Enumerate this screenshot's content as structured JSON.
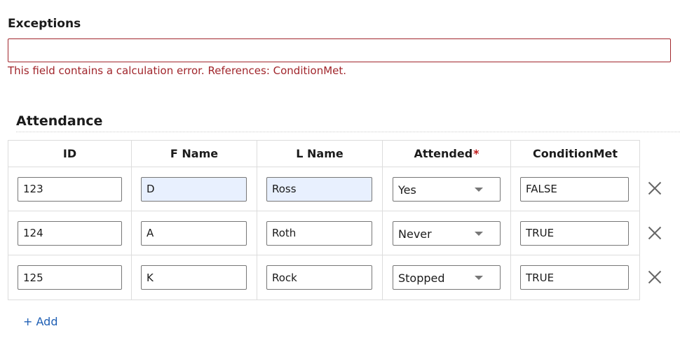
{
  "exceptions": {
    "label": "Exceptions",
    "value": "",
    "error": "This field contains a calculation error. References: ConditionMet."
  },
  "attendance": {
    "title": "Attendance",
    "columns": {
      "id": "ID",
      "fname": "F Name",
      "lname": "L Name",
      "attended": "Attended",
      "attended_required_mark": "*",
      "condition": "ConditionMet"
    },
    "rows": [
      {
        "id": "123",
        "fname": "D",
        "lname": "Ross",
        "attended": "Yes",
        "condition": "FALSE"
      },
      {
        "id": "124",
        "fname": "A",
        "lname": "Roth",
        "attended": "Never",
        "condition": "TRUE"
      },
      {
        "id": "125",
        "fname": "K",
        "lname": "Rock",
        "attended": "Stopped",
        "condition": "TRUE"
      }
    ],
    "add_label": "+ Add",
    "delete_icon": "close-icon"
  },
  "colors": {
    "error": "#a1262c",
    "required": "#c11b1b",
    "link": "#1f5fb4",
    "highlight": "#e8f0fe"
  }
}
